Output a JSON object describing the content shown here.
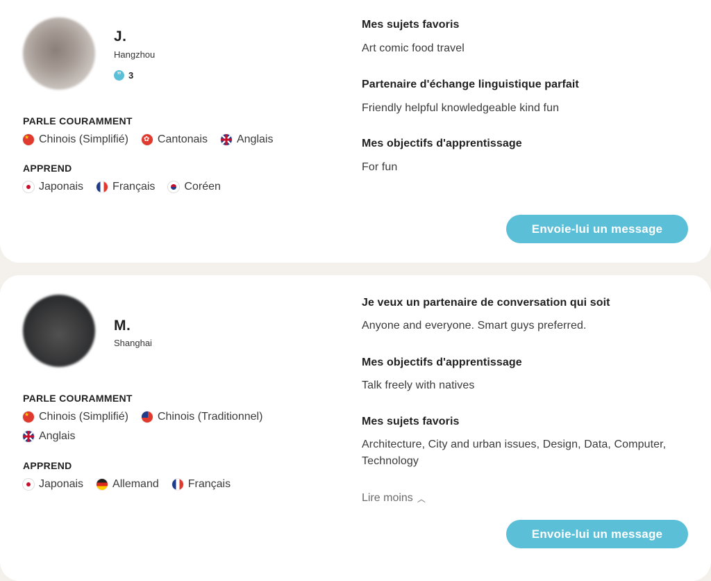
{
  "cards": [
    {
      "name": "J.",
      "city": "Hangzhou",
      "references": "3",
      "fluent_title": "PARLE COURAMMENT",
      "fluent": [
        "Chinois (Simplifié)",
        "Cantonais",
        "Anglais"
      ],
      "learning_title": "APPREND",
      "learning": [
        "Japonais",
        "Français",
        "Coréen"
      ],
      "sections": [
        {
          "title": "Mes sujets favoris",
          "text": "Art comic food travel"
        },
        {
          "title": "Partenaire d'échange linguistique parfait",
          "text": "Friendly helpful knowledgeable kind fun"
        },
        {
          "title": "Mes objectifs d'apprentissage",
          "text": "For fun"
        }
      ],
      "button": "Envoie-lui un message"
    },
    {
      "name": "M.",
      "city": "Shanghai",
      "fluent_title": "PARLE COURAMMENT",
      "fluent": [
        "Chinois (Simplifié)",
        "Chinois (Traditionnel)",
        "Anglais"
      ],
      "learning_title": "APPREND",
      "learning": [
        "Japonais",
        "Allemand",
        "Français"
      ],
      "sections": [
        {
          "title": "Je veux un partenaire de conversation qui soit",
          "text": "Anyone and everyone. Smart guys preferred."
        },
        {
          "title": "Mes objectifs d'apprentissage",
          "text": "Talk freely with natives"
        },
        {
          "title": "Mes sujets favoris",
          "text": "Architecture, City and urban issues, Design, Data, Computer, Technology"
        }
      ],
      "read_less": "Lire moins",
      "button": "Envoie-lui un message"
    }
  ],
  "icons": {
    "flags": [
      "china-flag-icon",
      "hong-kong-flag-icon",
      "uk-flag-icon",
      "japan-flag-icon",
      "france-flag-icon",
      "south-korea-flag-icon",
      "taiwan-flag-icon",
      "germany-flag-icon"
    ],
    "references": "quote-bubble-icon",
    "read_less": "chevron-up-icon"
  },
  "colors": {
    "accent": "#5bbfd8",
    "background": "#f4f1ec",
    "card": "#ffffff"
  }
}
